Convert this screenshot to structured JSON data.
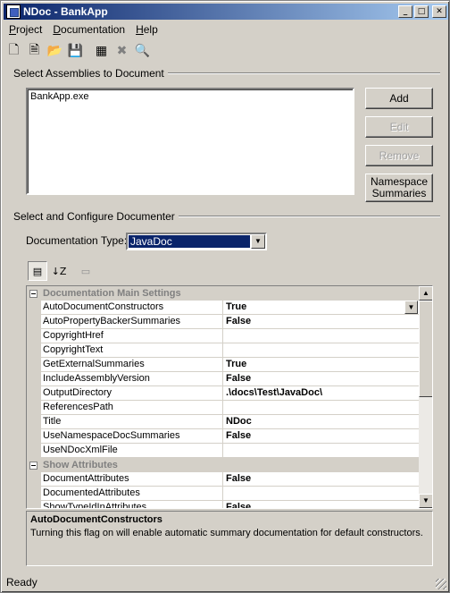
{
  "window": {
    "title": "NDoc - BankApp",
    "minimize": "_",
    "maximize": "□",
    "close": "✕"
  },
  "menu": [
    {
      "accel": "P",
      "rest": "roject"
    },
    {
      "accel": "D",
      "rest": "ocumentation"
    },
    {
      "accel": "H",
      "rest": "elp"
    }
  ],
  "toolbar": {
    "icons": [
      "new-project-icon",
      "open-wizard-icon",
      "open-folder-icon",
      "save-icon",
      "build-icon",
      "cancel-build-icon",
      "view-docs-icon"
    ],
    "glyphs": [
      "🗋",
      "🗎",
      "📂",
      "💾",
      "▦",
      "✖",
      "🔍"
    ]
  },
  "assemblies": {
    "label": "Select Assemblies to Document",
    "items": [
      "BankApp.exe"
    ],
    "add_label": "Add",
    "edit_label": "Edit",
    "remove_label": "Remove",
    "namespace_line1": "Namespace",
    "namespace_line2": "Summaries"
  },
  "documenter": {
    "label": "Select and Configure Documenter",
    "type_label": "Documentation Type:",
    "type_value": "JavaDoc"
  },
  "propertygrid": {
    "tool_icons": [
      "categorized-icon",
      "alphabetical-icon",
      "property-pages-icon"
    ],
    "tool_glyphs": [
      "▤",
      "↓Z",
      "▭"
    ],
    "categories": [
      {
        "name": "Documentation Main Settings",
        "properties": [
          {
            "name": "AutoDocumentConstructors",
            "value": "True"
          },
          {
            "name": "AutoPropertyBackerSummaries",
            "value": "False"
          },
          {
            "name": "CopyrightHref",
            "value": ""
          },
          {
            "name": "CopyrightText",
            "value": ""
          },
          {
            "name": "GetExternalSummaries",
            "value": "True"
          },
          {
            "name": "IncludeAssemblyVersion",
            "value": "False"
          },
          {
            "name": "OutputDirectory",
            "value": ".\\docs\\Test\\JavaDoc\\"
          },
          {
            "name": "ReferencesPath",
            "value": ""
          },
          {
            "name": "Title",
            "value": "NDoc"
          },
          {
            "name": "UseNamespaceDocSummaries",
            "value": "False"
          },
          {
            "name": "UseNDocXmlFile",
            "value": ""
          }
        ]
      },
      {
        "name": "Show Attributes",
        "properties": [
          {
            "name": "DocumentAttributes",
            "value": "False"
          },
          {
            "name": "DocumentedAttributes",
            "value": ""
          },
          {
            "name": "ShowTypeIdInAttributes",
            "value": "False"
          }
        ]
      }
    ],
    "selected": "AutoDocumentConstructors"
  },
  "description": {
    "title": "AutoDocumentConstructors",
    "text": "Turning this flag on will enable automatic summary documentation for default constructors."
  },
  "status": {
    "text": "Ready"
  }
}
